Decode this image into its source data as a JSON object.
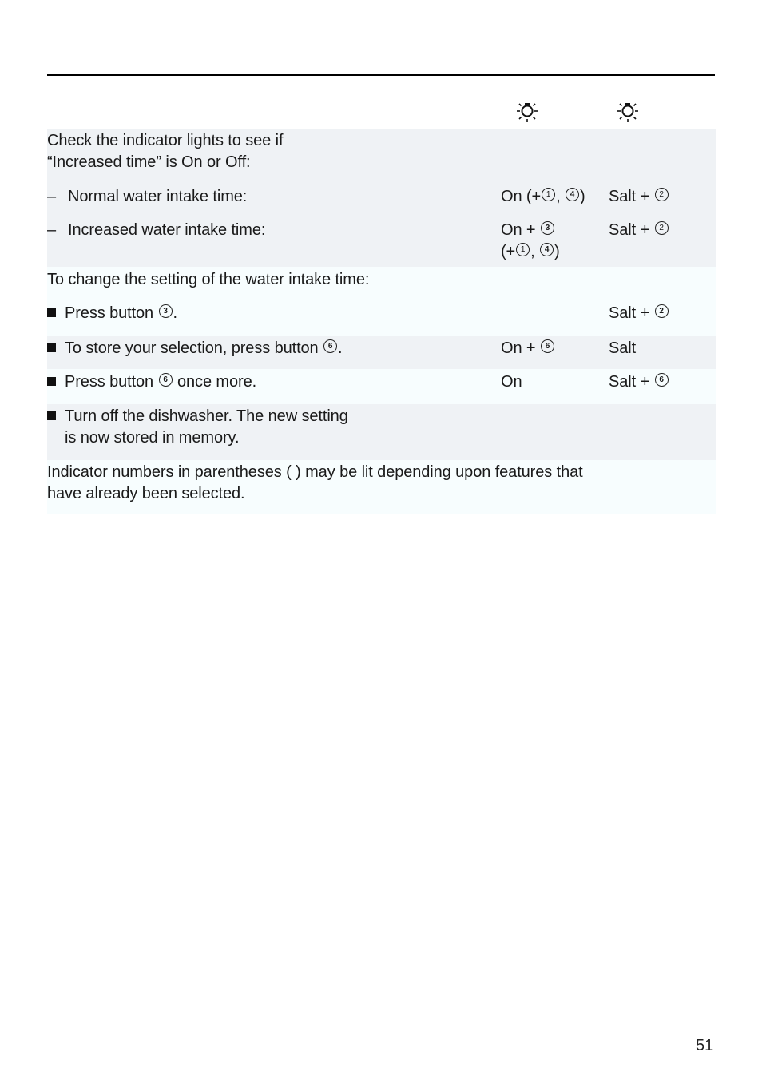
{
  "header": {
    "column_icons": [
      "indicator-light-icon",
      "indicator-light-icon"
    ]
  },
  "section1": {
    "intro_line1": "Check the indicator lights to see if",
    "intro_line2": "“Increased time” is On or Off:",
    "rows": [
      {
        "dash": "–",
        "label": "Normal water intake time:",
        "col1_prefix": "On (+",
        "col1_nums": [
          "1",
          "4"
        ],
        "col1_sep": ", ",
        "col1_suffix": ")",
        "col2_text": "Salt + ",
        "col2_num": "2"
      },
      {
        "dash": "–",
        "label": "Increased water intake time:",
        "col1_line1_text": "On + ",
        "col1_line1_num": "3",
        "col1_line2_prefix": "(+",
        "col1_line2_nums": [
          "1",
          "4"
        ],
        "col1_line2_sep": ", ",
        "col1_line2_suffix": ")",
        "col2_text": "Salt + ",
        "col2_num": "2"
      }
    ]
  },
  "section2": {
    "intro": "To change the setting of the water intake time:",
    "steps": [
      {
        "text_before": "Press button ",
        "num": "3",
        "text_after": ".",
        "col1_text": "",
        "col2_text": "Salt + ",
        "col2_num": "2"
      },
      {
        "text_before": "To store your selection, press button ",
        "num": "6",
        "text_after": ".",
        "col1_text": "On + ",
        "col1_num": "6",
        "col2_text": "Salt"
      },
      {
        "text_before": "Press button ",
        "num": "6",
        "text_after": " once more.",
        "col1_text": "On",
        "col2_text": "Salt + ",
        "col2_num": "6"
      },
      {
        "line1": "Turn off the dishwasher. The new setting",
        "line2": "is now stored in memory."
      }
    ]
  },
  "note": {
    "line1": "Indicator numbers in parentheses ( ) may be lit depending upon features that",
    "line2": "have already been selected."
  },
  "footer": {
    "page_number": "51"
  },
  "colors": {
    "band_gray": "#eff2f5",
    "band_light": "#f7fdfe",
    "text": "#1a1a1a"
  }
}
